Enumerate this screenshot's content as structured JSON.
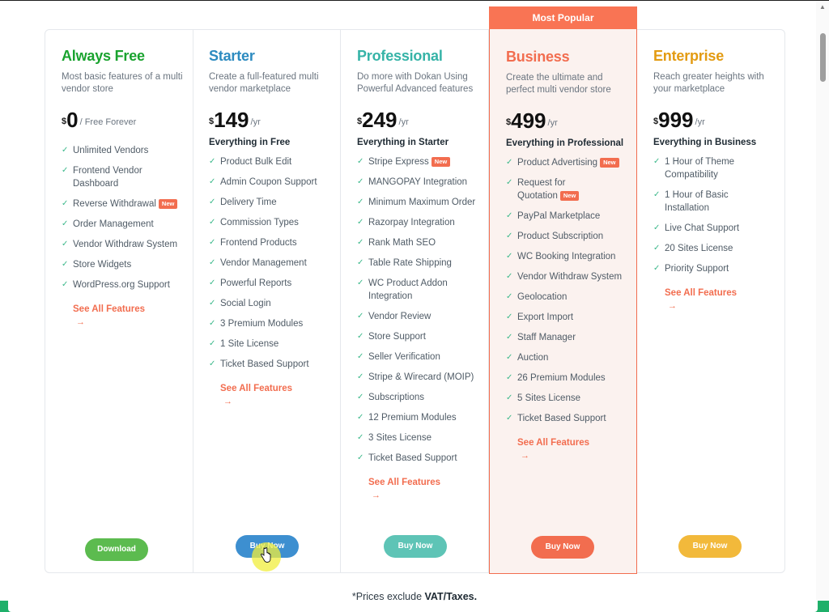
{
  "colors": {
    "free": "#1aa32f",
    "starter": "#2d8bc0",
    "professional": "#35b3a7",
    "business": "#f26d4f",
    "enterprise": "#e39b12",
    "badge": "#f97454",
    "check": "#3bb88a"
  },
  "plans": [
    {
      "name": "Always Free",
      "desc": "Most basic features of a multi vendor store",
      "currency": "$",
      "price": "0",
      "per": "/ Free Forever",
      "everything": "",
      "features": [
        {
          "text": "Unlimited Vendors",
          "new": ""
        },
        {
          "text": "Frontend Vendor Dashboard",
          "new": ""
        },
        {
          "text": "Reverse Withdrawal",
          "new": "New"
        },
        {
          "text": "Order Management",
          "new": ""
        },
        {
          "text": "Vendor Withdraw System",
          "new": ""
        },
        {
          "text": "Store Widgets",
          "new": ""
        },
        {
          "text": "WordPress.org Support",
          "new": ""
        }
      ],
      "see_all": "See All Features",
      "button": "Download",
      "button_color": "#5cbb4f"
    },
    {
      "name": "Starter",
      "desc": "Create a full-featured multi vendor marketplace",
      "currency": "$",
      "price": "149",
      "per": "/yr",
      "everything": "Everything in Free",
      "features": [
        {
          "text": "Product Bulk Edit",
          "new": ""
        },
        {
          "text": "Admin Coupon Support",
          "new": ""
        },
        {
          "text": "Delivery Time",
          "new": ""
        },
        {
          "text": "Commission Types",
          "new": ""
        },
        {
          "text": "Frontend Products",
          "new": ""
        },
        {
          "text": "Vendor Management",
          "new": ""
        },
        {
          "text": "Powerful Reports",
          "new": ""
        },
        {
          "text": "Social Login",
          "new": ""
        },
        {
          "text": "3 Premium Modules",
          "new": ""
        },
        {
          "text": "1 Site License",
          "new": ""
        },
        {
          "text": "Ticket Based Support",
          "new": ""
        }
      ],
      "see_all": "See All Features",
      "button": "Buy Now",
      "button_color": "#3d8fd0"
    },
    {
      "name": "Professional",
      "desc": "Do more with Dokan Using Powerful Advanced features",
      "currency": "$",
      "price": "249",
      "per": "/yr",
      "everything": "Everything in Starter",
      "features": [
        {
          "text": "Stripe Express",
          "new": "New"
        },
        {
          "text": "MANGOPAY Integration",
          "new": ""
        },
        {
          "text": "Minimum Maximum Order",
          "new": ""
        },
        {
          "text": "Razorpay Integration",
          "new": ""
        },
        {
          "text": "Rank Math SEO",
          "new": ""
        },
        {
          "text": "Table Rate Shipping",
          "new": ""
        },
        {
          "text": "WC Product Addon Integration",
          "new": ""
        },
        {
          "text": "Vendor Review",
          "new": ""
        },
        {
          "text": "Store Support",
          "new": ""
        },
        {
          "text": "Seller Verification",
          "new": ""
        },
        {
          "text": "Stripe & Wirecard (MOIP)",
          "new": ""
        },
        {
          "text": "Subscriptions",
          "new": ""
        },
        {
          "text": "12 Premium Modules",
          "new": ""
        },
        {
          "text": "3 Sites License",
          "new": ""
        },
        {
          "text": "Ticket Based Support",
          "new": ""
        }
      ],
      "see_all": "See All Features",
      "button": "Buy Now",
      "button_color": "#5ec4b6"
    },
    {
      "name": "Business",
      "desc": "Create the ultimate and perfect multi vendor store",
      "currency": "$",
      "price": "499",
      "per": "/yr",
      "everything": "Everything in Professional",
      "features": [
        {
          "text": "Product Advertising",
          "new": "New"
        },
        {
          "text": "Request for Quotation",
          "new": "New"
        },
        {
          "text": "PayPal Marketplace",
          "new": ""
        },
        {
          "text": "Product Subscription",
          "new": ""
        },
        {
          "text": "WC Booking Integration",
          "new": ""
        },
        {
          "text": "Vendor Withdraw System",
          "new": ""
        },
        {
          "text": "Geolocation",
          "new": ""
        },
        {
          "text": "Export Import",
          "new": ""
        },
        {
          "text": "Staff Manager",
          "new": ""
        },
        {
          "text": "Auction",
          "new": ""
        },
        {
          "text": "26 Premium Modules",
          "new": ""
        },
        {
          "text": "5 Sites License",
          "new": ""
        },
        {
          "text": "Ticket Based Support",
          "new": ""
        }
      ],
      "see_all": "See All Features",
      "button": "Buy Now",
      "button_color": "#f26d4f",
      "badge": "Most Popular"
    },
    {
      "name": "Enterprise",
      "desc": "Reach greater heights with your marketplace",
      "currency": "$",
      "price": "999",
      "per": "/yr",
      "everything": "Everything in Business",
      "features": [
        {
          "text": "1 Hour of Theme Compatibility",
          "new": ""
        },
        {
          "text": "1 Hour of Basic Installation",
          "new": ""
        },
        {
          "text": "Live Chat Support",
          "new": ""
        },
        {
          "text": "20 Sites License",
          "new": ""
        },
        {
          "text": "Priority Support",
          "new": ""
        }
      ],
      "see_all": "See All Features",
      "button": "Buy Now",
      "button_color": "#f2b93b"
    }
  ],
  "footnote": {
    "prefix": "*Prices exclude ",
    "bold": "VAT/Taxes."
  },
  "icons": {
    "check": "check-icon",
    "arrow": "arrow-right-icon",
    "cursor": "hand-pointer-icon"
  }
}
